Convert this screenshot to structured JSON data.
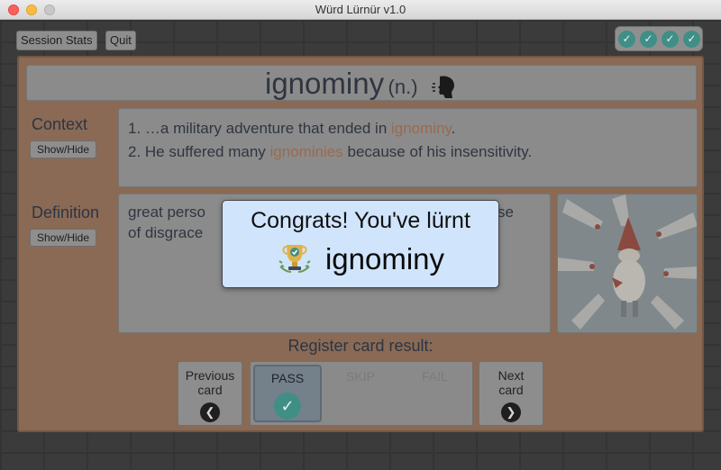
{
  "window": {
    "title": "Würd Lürnür v1.0"
  },
  "toolbar": {
    "session_stats": "Session Stats",
    "quit": "Quit"
  },
  "progress": {
    "completed": 4,
    "icon": "check-circle-icon"
  },
  "card": {
    "word": "ignominy",
    "part_of_speech": "(n.)",
    "context_label": "Context",
    "context_toggle": "Show/Hide",
    "context_1_pre": "1. …a military adventure that ended in ",
    "context_1_hl": "ignominy",
    "context_1_post": ".",
    "context_2_pre": "2. He suffered many ",
    "context_2_hl": "ignominies",
    "context_2_post": " because of his insensitivity.",
    "definition_label": "Definition",
    "definition_toggle": "Show/Hide",
    "definition_visible_1": "great perso",
    "definition_visible_1_tail": "se",
    "definition_visible_2": "of disgrace"
  },
  "register": {
    "label": "Register card result:",
    "previous": [
      "Previous",
      "card"
    ],
    "next": [
      "Next",
      "card"
    ],
    "pass": "PASS",
    "skip": "SKIP",
    "fail": "FAIL"
  },
  "modal": {
    "title": "Congrats! You've lürnt",
    "word": "ignominy",
    "icon": "trophy-icon"
  },
  "colors": {
    "accent_teal": "#3f8f87",
    "highlight": "#c87a4e",
    "modal_bg": "#d0e4fb",
    "panel_orange": "#e5875a"
  }
}
